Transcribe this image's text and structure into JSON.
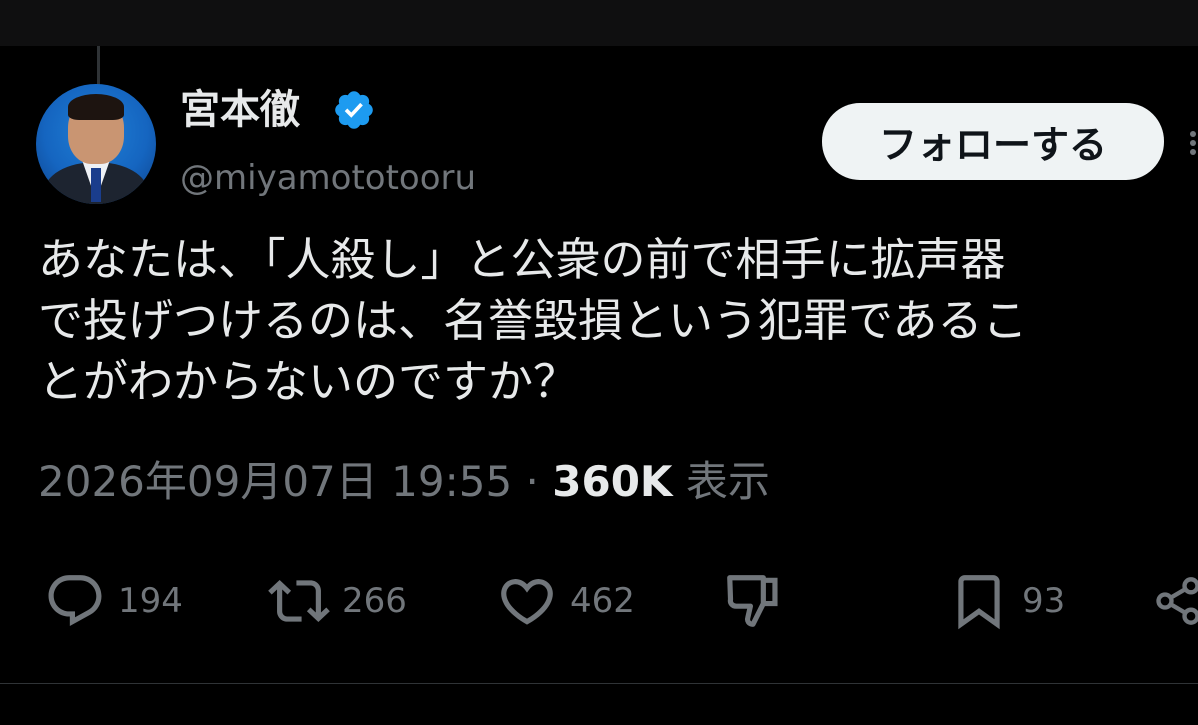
{
  "user": {
    "display_name": "宮本徹",
    "handle": "@miyamototooru",
    "verified": true
  },
  "follow_button": {
    "label": "フォローする"
  },
  "tweet": {
    "lines": [
      "あなたは、「人殺し」と公衆の前で相手に拡声器",
      "で投げつけるのは、名誉毀損という犯罪であるこ",
      "とがわからないのですか？"
    ],
    "timestamp": "2026年09月07日 19:55",
    "separator": "·",
    "views_count": "360K",
    "views_label": "表示"
  },
  "actions": {
    "reply": {
      "icon": "reply-icon",
      "count": "194"
    },
    "retweet": {
      "icon": "retweet-icon",
      "count": "266"
    },
    "like": {
      "icon": "heart-icon",
      "count": "462"
    },
    "dislike": {
      "icon": "thumbs-down-icon"
    },
    "bookmark": {
      "icon": "bookmark-icon",
      "count": "93"
    },
    "share": {
      "icon": "share-icon"
    }
  },
  "colors": {
    "background": "#000000",
    "text": "#e7e9ea",
    "muted": "#71767b",
    "verified": "#1d9bf0",
    "follow_bg": "#eff3f4"
  }
}
